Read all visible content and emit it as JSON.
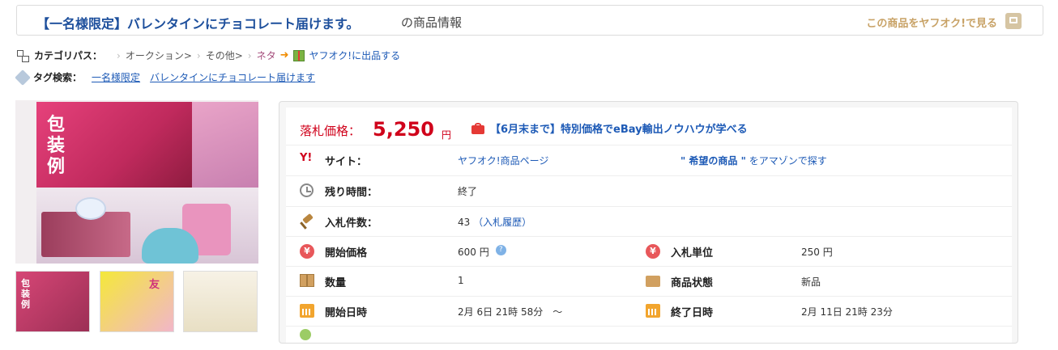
{
  "header": {
    "title": "【一名様限定】バレンタインにチョコレート届けます。",
    "suffix": "の商品情報",
    "view_link": "この商品をヤフオク!で見る"
  },
  "breadcrumb": {
    "label": "カテゴリパス：",
    "items": [
      "オークション>",
      "その他>",
      "ネタ"
    ],
    "list_link": "ヤフオク!に出品する"
  },
  "tags": {
    "label": "タグ検索：",
    "items": [
      "一名様限定",
      "バレンタインにチョコレート届けます"
    ]
  },
  "photo": {
    "overlay_text": "包装例"
  },
  "thumbnails": [
    {
      "text": "包装例"
    },
    {
      "text": "友"
    },
    {
      "text": ""
    }
  ],
  "price": {
    "label": "落札価格：",
    "value": "5,250",
    "unit": "円",
    "promo": "【6月末まで】特別価格でeBay輸出ノウハウが学べる"
  },
  "site": {
    "label": "サイト：",
    "link1": "ヤフオク!商品ページ",
    "link2_quoted": "\" 希望の商品 \"",
    "link2_suffix": " をアマゾンで探す"
  },
  "time_left": {
    "label": "残り時間：",
    "value": "終了"
  },
  "bids": {
    "label": "入札件数：",
    "count": "43",
    "history_link": "（入札履歴）"
  },
  "start_price": {
    "label": "開始価格",
    "value": "600 円",
    "help": "?"
  },
  "bid_unit": {
    "label": "入札単位",
    "value": "250 円"
  },
  "quantity": {
    "label": "数量",
    "value": "1"
  },
  "condition": {
    "label": "商品状態",
    "value": "新品"
  },
  "start_date": {
    "label": "開始日時",
    "value": "2月 6日 21時 58分　～"
  },
  "end_date": {
    "label": "終了日時",
    "value": "2月 11日 21時 23分"
  },
  "icons": {
    "site": "yahoo-y-icon",
    "yen": "yen-icon",
    "calendar": "calendar-icon"
  },
  "colors": {
    "price": "#d0021b",
    "link": "#1d5ab6",
    "title": "#1d4f9c"
  }
}
